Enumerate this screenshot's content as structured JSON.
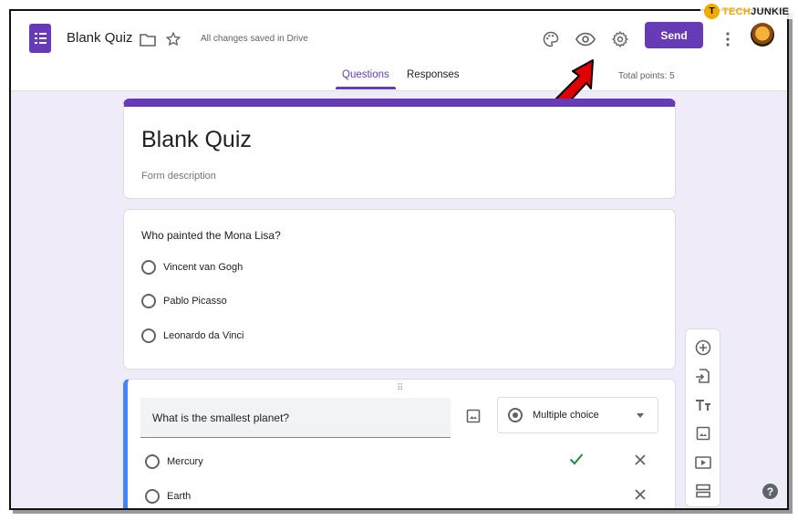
{
  "header": {
    "title": "Blank Quiz",
    "saved_status": "All changes saved in Drive",
    "send_label": "Send",
    "tabs": [
      {
        "label": "Questions",
        "active": true
      },
      {
        "label": "Responses",
        "active": false
      }
    ],
    "total_points": "Total points: 5"
  },
  "watermark": {
    "logo": "T",
    "part_a": "TECH",
    "part_b": "JUNKIE"
  },
  "form": {
    "title": "Blank Quiz",
    "description_placeholder": "Form description"
  },
  "questions": [
    {
      "text": "Who painted the Mona Lisa?",
      "options": [
        "Vincent van Gogh",
        "Pablo Picasso",
        "Leonardo da Vinci"
      ]
    },
    {
      "text": "What is the smallest planet?",
      "type": "Multiple choice",
      "options": [
        "Mercury",
        "Earth"
      ]
    }
  ],
  "colors": {
    "accent": "#673ab7",
    "active_question": "#4285f4",
    "correct": "#1e8e3e",
    "arrow": "#e00000"
  },
  "icons": [
    "forms-logo-icon",
    "folder-icon",
    "star-icon",
    "palette-icon",
    "eye-icon",
    "gear-icon",
    "more-vert-icon",
    "add-circle-icon",
    "import-icon",
    "title-icon",
    "image-icon",
    "video-icon",
    "section-icon",
    "help-icon",
    "check-icon",
    "close-icon"
  ]
}
